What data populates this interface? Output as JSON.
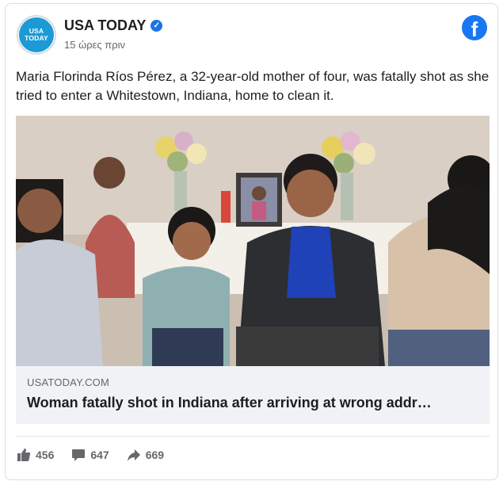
{
  "post": {
    "page_name": "USA TODAY",
    "timestamp": "15 ώρες πριν",
    "avatar_text": "USA TODAY",
    "text": "Maria Florinda Ríos Pérez, a 32-year-old mother of four, was fatally shot as she tried to enter a Whitestown, Indiana, home to clean it."
  },
  "link": {
    "domain": "USATODAY.COM",
    "title": "Woman fatally shot in Indiana after arriving at wrong addr…"
  },
  "reactions": {
    "likes": "456",
    "comments": "647",
    "shares": "669"
  },
  "colors": {
    "brand_blue": "#1877f2",
    "usa_today_blue": "#1b9ad6",
    "muted_text": "#65676b"
  },
  "icons": [
    "verified-badge-icon",
    "facebook-logo-icon",
    "like-icon",
    "comment-icon",
    "share-icon"
  ]
}
